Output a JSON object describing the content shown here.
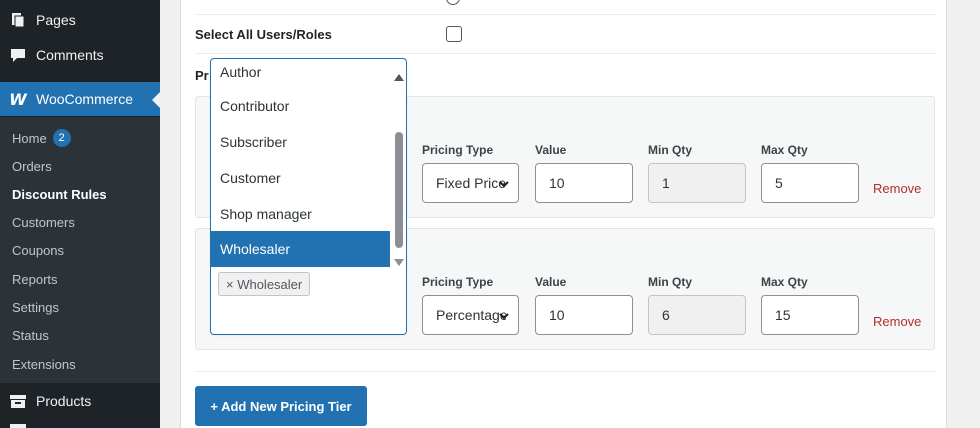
{
  "sidebar": {
    "top_items": [
      {
        "label": "Pages",
        "icon": "pages-icon"
      },
      {
        "label": "Comments",
        "icon": "comments-icon"
      },
      {
        "label": "WooCommerce",
        "icon": "woocommerce-icon"
      },
      {
        "label": "Products",
        "icon": "products-icon"
      }
    ],
    "submenu": [
      {
        "label": "Home",
        "badge": "2"
      },
      {
        "label": "Orders"
      },
      {
        "label": "Discount Rules"
      },
      {
        "label": "Customers"
      },
      {
        "label": "Coupons"
      },
      {
        "label": "Reports"
      },
      {
        "label": "Settings"
      },
      {
        "label": "Status"
      },
      {
        "label": "Extensions"
      }
    ],
    "colors": {
      "bg": "#1d2327",
      "submenu_bg": "#2c3338",
      "accent": "#2271b1"
    }
  },
  "form": {
    "select_all_label": "Select All Users/Roles",
    "section_label_partial": "Pr"
  },
  "tiers": [
    {
      "pricing_type_label": "Pricing Type",
      "pricing_type_value": "Fixed Price",
      "value_label": "Value",
      "value": "10",
      "min_qty_label": "Min Qty",
      "min_qty": "1",
      "max_qty_label": "Max Qty",
      "max_qty": "5",
      "remove_label": "Remove"
    },
    {
      "pricing_type_label": "Pricing Type",
      "pricing_type_value": "Percentage",
      "value_label": "Value",
      "value": "10",
      "min_qty_label": "Min Qty",
      "min_qty": "6",
      "max_qty_label": "Max Qty",
      "max_qty": "15",
      "remove_label": "Remove"
    }
  ],
  "dropdown": {
    "options": [
      "Author",
      "Contributor",
      "Subscriber",
      "Customer",
      "Shop manager",
      "Wholesaler"
    ],
    "highlighted": "Wholesaler",
    "selected_tag": "× Wholesaler"
  },
  "add_tier_button": "+ Add New Pricing Tier"
}
